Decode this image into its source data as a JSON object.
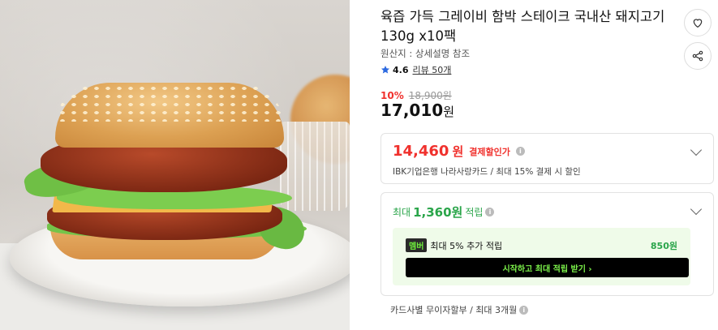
{
  "product": {
    "title": "육즙 가득 그레이비 함박 스테이크 국내산 돼지고기 130g x10팩",
    "origin": "원산지 : 상세설명 참조",
    "rating": "4.6",
    "reviews": "리뷰 50개"
  },
  "pricing": {
    "discount_rate": "10%",
    "original_price": "18,900원",
    "sale_price": "17,010",
    "sale_unit": "원"
  },
  "card_discount": {
    "price": "14,460",
    "unit": "원",
    "label": "결제할인가",
    "description": "IBK기업은행 나라사랑카드 / 최대 15% 결제 시 할인"
  },
  "points": {
    "prefix": "최대",
    "amount": "1,360원",
    "suffix": "적립",
    "member_badge": "멤버",
    "member_text": "최대 5% 추가 적립",
    "member_points": "850원",
    "join_button": "시작하고 최대 적립 받기 ›"
  },
  "installment": "카드사별 무이자할부 / 최대 3개월",
  "icons": {
    "heart": "heart-icon",
    "share": "share-icon",
    "star": "star-icon",
    "chevron": "chevron-down-icon",
    "info": "info-icon"
  },
  "colors": {
    "discount_red": "#f0312d",
    "points_green": "#2aa54a",
    "member_bg": "#effbe9",
    "star_blue": "#2d6ae0"
  }
}
